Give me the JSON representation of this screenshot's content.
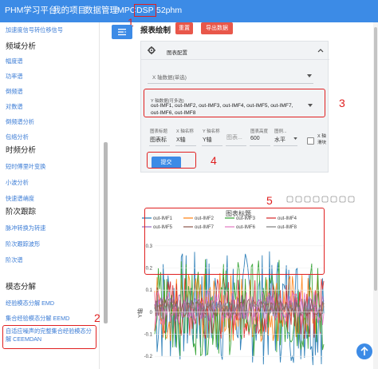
{
  "nav": {
    "brand": "PHM学习平台",
    "items": [
      "我的项目",
      "数据管理",
      "MPC",
      "DSP",
      "52phm"
    ]
  },
  "annotations": {
    "n1": "1",
    "n2": "2",
    "n3": "3",
    "n4": "4",
    "n5": "5"
  },
  "sidebar": {
    "top_link": "加速度信号转位移信号",
    "sections": [
      {
        "title": "频域分析",
        "items": [
          "幅度谱",
          "功率谱",
          "倒频谱",
          "对数谱",
          "倒频谱分析",
          "包络分析"
        ]
      },
      {
        "title": "时频分析",
        "items": [
          "短时傅里叶变换",
          "小波分析",
          "快速谱峭度"
        ]
      },
      {
        "title": "阶次跟踪",
        "items": [
          "脉冲转换为转速",
          "阶次跟踪波形",
          "阶次谱"
        ]
      },
      {
        "title": "模态分解",
        "items": [
          "经验模态分解 EMD",
          "集合经验模态分解 EEMD",
          "自适应噪声的完整集合经验模态分解 CEEMDAN"
        ]
      }
    ]
  },
  "main": {
    "title": "报表绘制",
    "clear_button": "重置",
    "export_button": "导出数据",
    "config_title": "图表配置",
    "x_axis_placeholder": "X 轴数据(单选)",
    "y_axis_label": "Y 轴数据(可多选)",
    "y_axis_value": "out-IMF1, out-IMF2, out-IMF3, out-IMF4, out-IMF5, out-IMF7, out-IMF6, out-IMF8",
    "fields": [
      {
        "label": "图表标题",
        "value": "图表标"
      },
      {
        "label": "X 轴名称",
        "value": "X轴"
      },
      {
        "label": "Y 轴名称",
        "value": "Y轴"
      },
      {
        "label": "图表...",
        "value": "图表..."
      },
      {
        "label": "图表高度",
        "value": "600"
      },
      {
        "label": "图例...",
        "value": "水平"
      }
    ],
    "checkbox_label": "X 轴滑块",
    "submit_button": "提交"
  },
  "chart_data": {
    "type": "line",
    "title": "图表标题",
    "ylabel": "Y轴",
    "y_ticks": [
      "0.3",
      "0.2",
      "0.1",
      "0",
      "-0.1",
      "-0.2"
    ],
    "series": [
      {
        "name": "out-IMF1",
        "color": "#1f77b4"
      },
      {
        "name": "out-IMF2",
        "color": "#ff7f0e"
      },
      {
        "name": "out-IMF3",
        "color": "#2ca02c"
      },
      {
        "name": "out-IMF4",
        "color": "#d62728"
      },
      {
        "name": "out-IMF5",
        "color": "#9467bd"
      },
      {
        "name": "out-IMF7",
        "color": "#8c564b"
      },
      {
        "name": "out-IMF6",
        "color": "#e377c2"
      },
      {
        "name": "out-IMF8",
        "color": "#7f7f7f"
      }
    ],
    "ylim": [
      -0.25,
      0.35
    ]
  },
  "fab_icon": "arrow-up-icon"
}
